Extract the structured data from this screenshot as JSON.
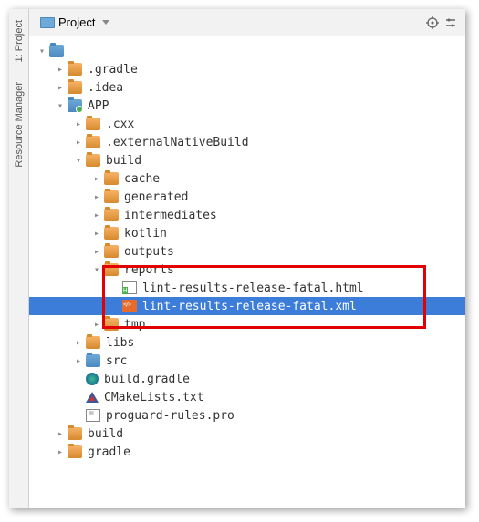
{
  "toolbar": {
    "project_label": "Project"
  },
  "side_tabs": {
    "project": "1: Project",
    "resource_manager": "Resource Manager"
  },
  "tree": [
    {
      "depth": 0,
      "chev": "down",
      "icon": "folder-blue",
      "label": ""
    },
    {
      "depth": 1,
      "chev": "right",
      "icon": "folder-orange",
      "label": ".gradle"
    },
    {
      "depth": 1,
      "chev": "right",
      "icon": "folder-orange",
      "label": ".idea"
    },
    {
      "depth": 1,
      "chev": "down",
      "icon": "folder-blue folder-blue-dot",
      "label": "APP"
    },
    {
      "depth": 2,
      "chev": "right",
      "icon": "folder-orange",
      "label": ".cxx"
    },
    {
      "depth": 2,
      "chev": "right",
      "icon": "folder-orange",
      "label": ".externalNativeBuild"
    },
    {
      "depth": 2,
      "chev": "down",
      "icon": "folder-orange",
      "label": "build"
    },
    {
      "depth": 3,
      "chev": "right",
      "icon": "folder-orange",
      "label": "cache"
    },
    {
      "depth": 3,
      "chev": "right",
      "icon": "folder-orange",
      "label": "generated"
    },
    {
      "depth": 3,
      "chev": "right",
      "icon": "folder-orange",
      "label": "intermediates"
    },
    {
      "depth": 3,
      "chev": "right",
      "icon": "folder-orange",
      "label": "kotlin"
    },
    {
      "depth": 3,
      "chev": "right",
      "icon": "folder-orange",
      "label": "outputs"
    },
    {
      "depth": 3,
      "chev": "down",
      "icon": "folder-orange",
      "label": "reports"
    },
    {
      "depth": 4,
      "chev": "none",
      "icon": "file-html",
      "label": "lint-results-release-fatal.html"
    },
    {
      "depth": 4,
      "chev": "none",
      "icon": "file-xml",
      "label": "lint-results-release-fatal.xml",
      "selected": true
    },
    {
      "depth": 3,
      "chev": "right",
      "icon": "folder-orange",
      "label": "tmp"
    },
    {
      "depth": 2,
      "chev": "right",
      "icon": "folder-orange",
      "label": "libs"
    },
    {
      "depth": 2,
      "chev": "right",
      "icon": "folder-blue",
      "label": "src"
    },
    {
      "depth": 2,
      "chev": "none",
      "icon": "file-gradle",
      "label": "build.gradle"
    },
    {
      "depth": 2,
      "chev": "none",
      "icon": "file-cmake",
      "label": "CMakeLists.txt"
    },
    {
      "depth": 2,
      "chev": "none",
      "icon": "file-txt",
      "label": "proguard-rules.pro"
    },
    {
      "depth": 1,
      "chev": "right",
      "icon": "folder-orange",
      "label": "build"
    },
    {
      "depth": 1,
      "chev": "right",
      "icon": "folder-orange",
      "label": "gradle"
    }
  ]
}
